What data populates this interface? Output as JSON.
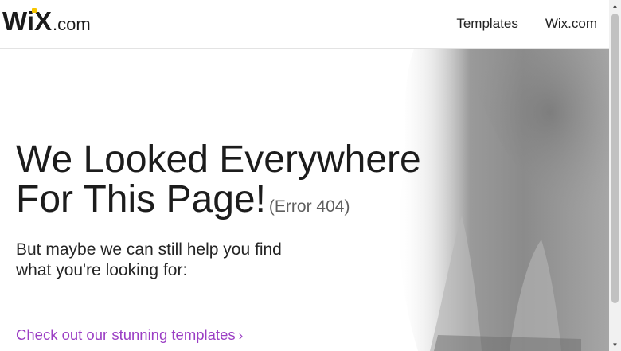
{
  "header": {
    "logo_main": "WiX",
    "logo_tld": ".com",
    "nav": [
      "Templates",
      "Wix.com"
    ]
  },
  "error_page": {
    "title_line1": "We Looked Everywhere",
    "title_line2": "For This Page!",
    "error_code": "(Error 404)",
    "subtitle_line1": "But maybe we can still help you find",
    "subtitle_line2": "what you're looking for:",
    "cta_label": "Check out our stunning templates",
    "cta_chevron": "›"
  },
  "colors": {
    "logo_dot": "#f7c600",
    "cta": "#9b3ec4",
    "text": "#1c1c1c"
  },
  "scrollbar": {
    "up_icon": "▲",
    "down_icon": "▼"
  }
}
